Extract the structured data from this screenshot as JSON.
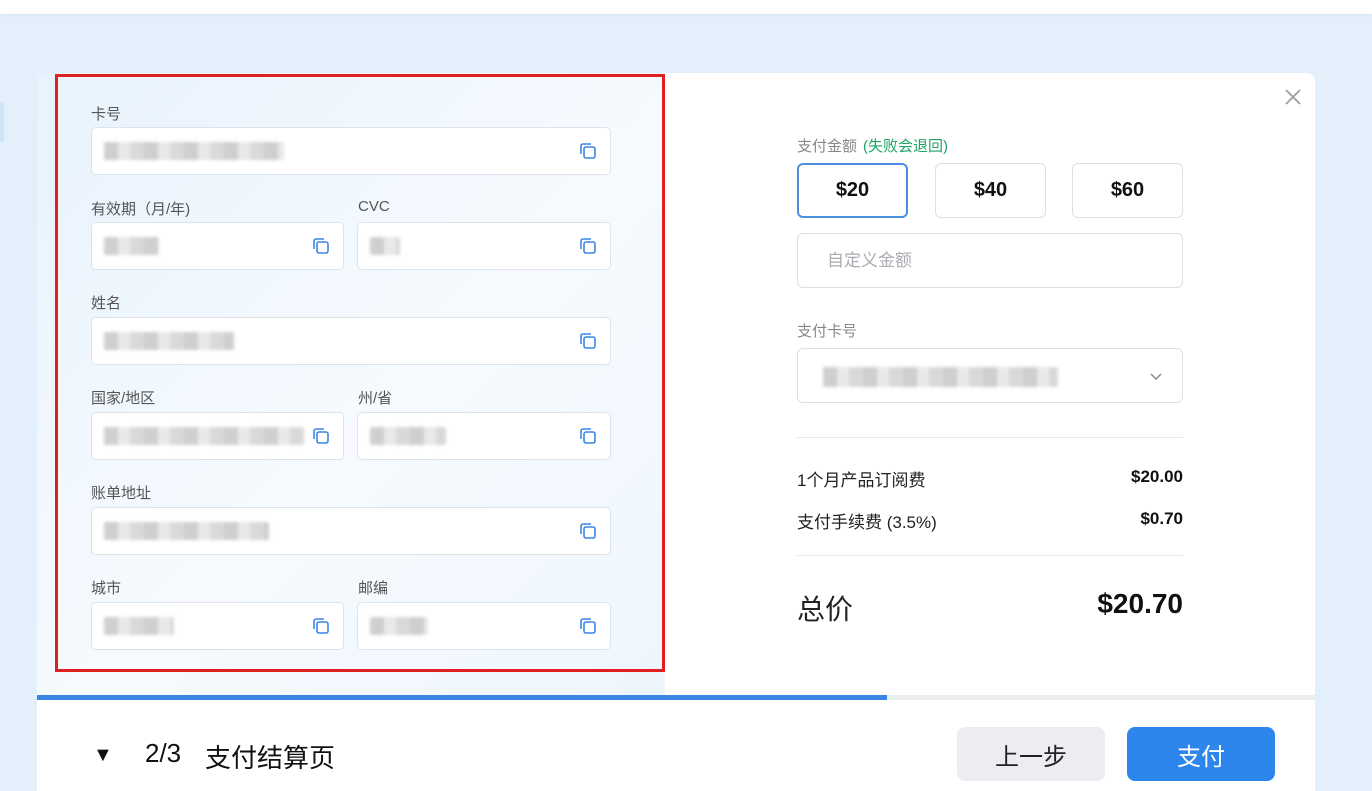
{
  "form": {
    "card_number_label": "卡号",
    "expiry_label": "有效期（月/年)",
    "cvc_label": "CVC",
    "name_label": "姓名",
    "country_label": "国家/地区",
    "state_label": "州/省",
    "address_label": "账单地址",
    "city_label": "城市",
    "zip_label": "邮编"
  },
  "payment": {
    "amount_label": "支付金额",
    "amount_note": "(失败会退回)",
    "amounts": [
      "$20",
      "$40",
      "$60"
    ],
    "selected_amount": "$20",
    "custom_placeholder": "自定义金额",
    "card_label": "支付卡号",
    "lines": [
      {
        "label": "1个月产品订阅费",
        "value": "$20.00"
      },
      {
        "label": "支付手续费 (3.5%)",
        "value": "$0.70"
      }
    ],
    "total_label": "总价",
    "total_value": "$20.70"
  },
  "footer": {
    "step_count": "2/3",
    "step_title": "支付结算页",
    "prev_label": "上一步",
    "pay_label": "支付",
    "progress_fraction": 0.665
  },
  "icons": {
    "copy": "copy-icon",
    "close": "close-icon",
    "chevron": "chevron-down-icon",
    "collapse": "triangle-down-icon"
  },
  "colors": {
    "accent": "#2d86ec",
    "highlight": "#e02020",
    "note": "#21a366"
  }
}
